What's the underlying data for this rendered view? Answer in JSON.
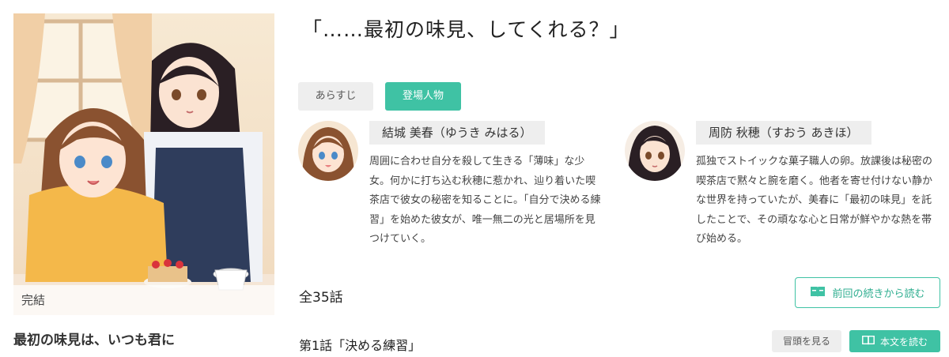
{
  "episode": {
    "title": "「……最初の味見、してくれる？」"
  },
  "tabs": {
    "synopsis": "あらすじ",
    "characters": "登場人物"
  },
  "characters": [
    {
      "name": "結城 美春（ゆうき みはる）",
      "description": "周囲に合わせ自分を殺して生きる「薄味」な少女。何かに打ち込む秋穂に惹かれ、辿り着いた喫茶店で彼女の秘密を知ることに。「自分で決める練習」を始めた彼女が、唯一無二の光と居場所を見つけていく。"
    },
    {
      "name": "周防 秋穂（すおう あきほ）",
      "description": "孤独でストイックな菓子職人の卵。放課後は秘密の喫茶店で黙々と腕を磨く。他者を寄せ付けない静かな世界を持っていたが、美春に「最初の味見」を託したことで、その頑なな心と日常が鮮やかな熱を帯び始める。"
    }
  ],
  "cover": {
    "status": "完結"
  },
  "book": {
    "title": "最初の味見は、いつも君に"
  },
  "episodes": {
    "count_label": "全35話",
    "continue_label": "前回の続きから読む",
    "first": {
      "title": "第1話「決める練習」",
      "preview_label": "冒頭を見る",
      "read_label": "本文を読む"
    }
  },
  "colors": {
    "accent": "#3fc2a4",
    "tab_inactive": "#eeeeee"
  },
  "icons": {
    "continue": "book-open-icon",
    "read": "book-open-icon"
  }
}
